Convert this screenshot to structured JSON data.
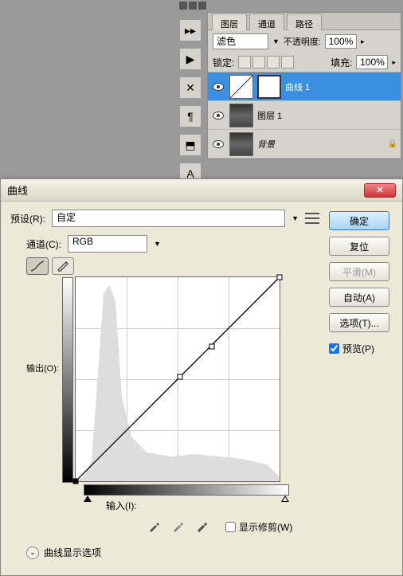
{
  "panel": {
    "tabs": [
      "图层",
      "通道",
      "路径"
    ],
    "blend_mode": "滤色",
    "opacity_label": "不透明度:",
    "opacity_value": "100%",
    "lock_label": "锁定:",
    "fill_label": "填充:",
    "fill_value": "100%",
    "layers": [
      {
        "name": "曲线 1",
        "type": "curves",
        "selected": true
      },
      {
        "name": "图层 1",
        "type": "image",
        "selected": false
      },
      {
        "name": "背景",
        "type": "bg",
        "selected": false,
        "locked": true,
        "italic": true
      }
    ]
  },
  "dialog": {
    "title": "曲线",
    "preset_label": "预设(R):",
    "preset_value": "自定",
    "channel_label": "通道(C):",
    "channel_value": "RGB",
    "output_label": "输出(O):",
    "input_label": "输入(I):",
    "show_clip": "显示修剪(W)",
    "display_options": "曲线显示选项",
    "ok": "确定",
    "reset": "复位",
    "smooth": "平滑(M)",
    "auto": "自动(A)",
    "options": "选项(T)...",
    "preview": "预览(P)"
  },
  "chart_data": {
    "type": "line",
    "title": "曲线",
    "xlabel": "输入",
    "ylabel": "输出",
    "xlim": [
      0,
      255
    ],
    "ylim": [
      0,
      255
    ],
    "series": [
      {
        "name": "RGB",
        "x": [
          0,
          130,
          170,
          255
        ],
        "y": [
          0,
          130,
          170,
          255
        ]
      }
    ],
    "histogram_note": "background histogram has tall spike near input≈30-50, lower rolling values elsewhere"
  }
}
